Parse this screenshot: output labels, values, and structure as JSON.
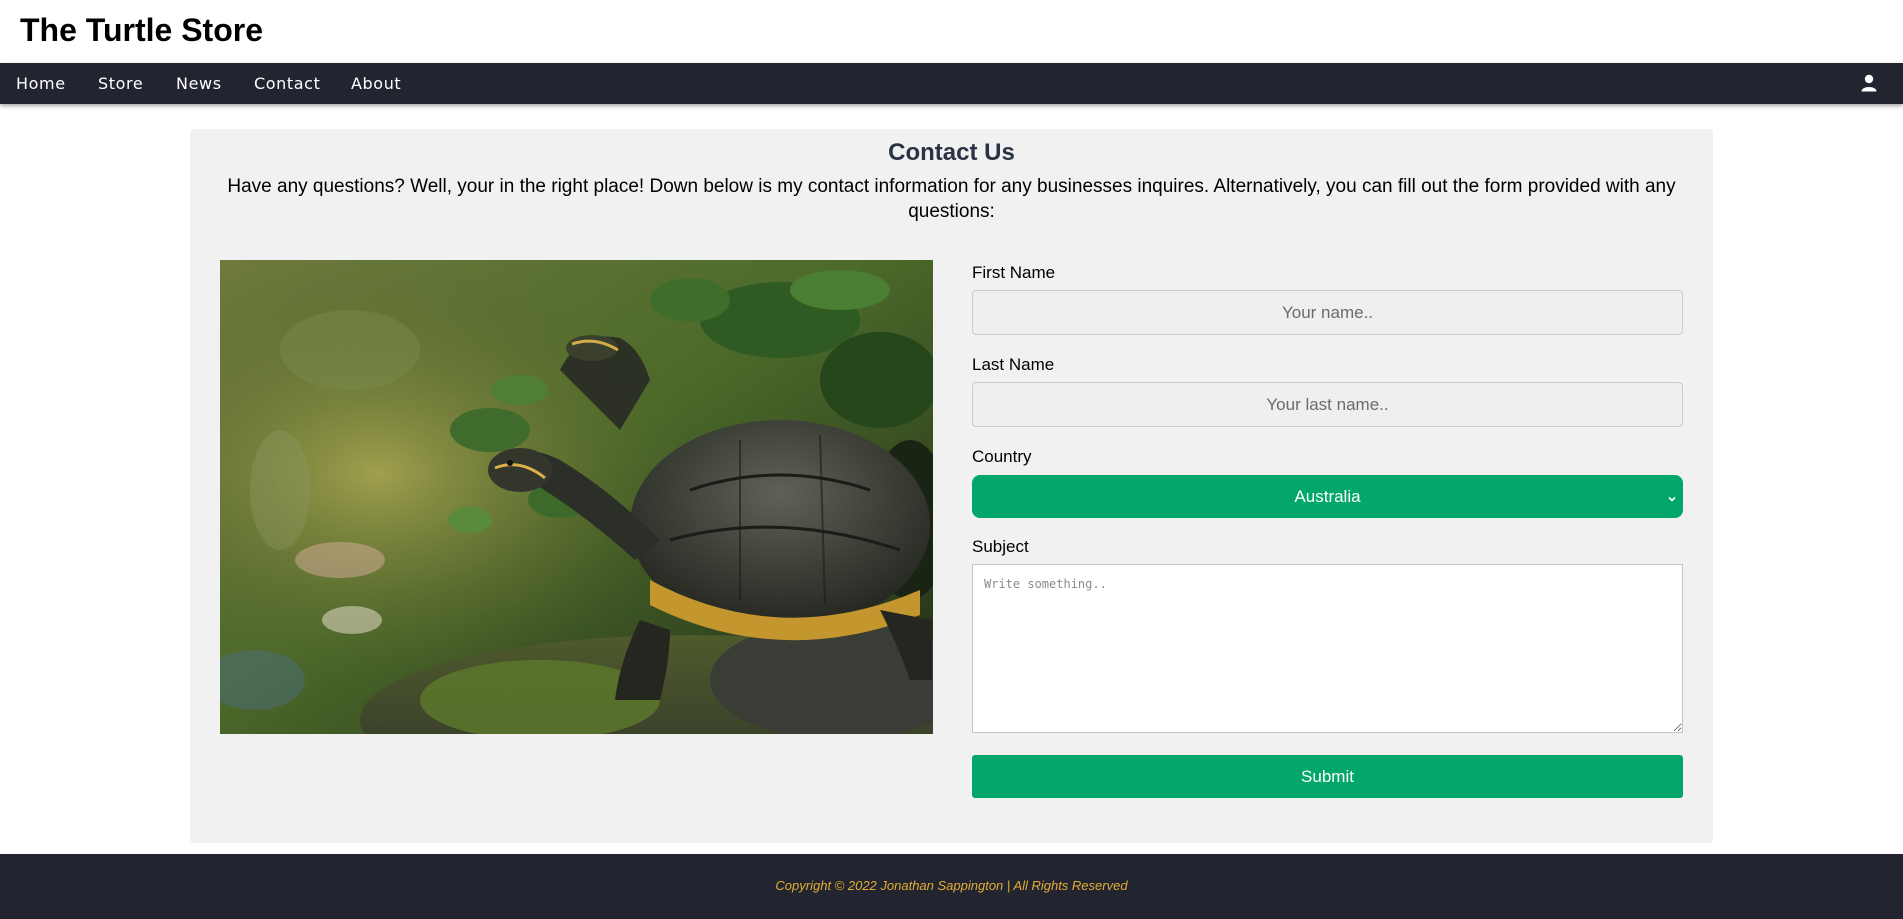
{
  "site": {
    "title": "The Turtle Store"
  },
  "nav": {
    "items": [
      "Home",
      "Store",
      "News",
      "Contact",
      "About"
    ],
    "user_icon": "user-icon"
  },
  "contact": {
    "heading": "Contact Us",
    "intro": "Have any questions? Well, your in the right place! Down below is my contact information for any businesses inquires. Alternatively, you can fill out the form provided with any questions:",
    "image_subject": "turtle on mossy rock"
  },
  "form": {
    "first_name_label": "First Name",
    "first_name_placeholder": "Your name..",
    "first_name_value": "",
    "last_name_label": "Last Name",
    "last_name_placeholder": "Your last name..",
    "last_name_value": "",
    "country_label": "Country",
    "country_selected": "Australia",
    "subject_label": "Subject",
    "subject_placeholder": "Write something..",
    "submit_label": "Submit"
  },
  "footer": {
    "copyright": "Copyright © 2022 Jonathan Sappington | All Rights Reserved"
  },
  "colors": {
    "nav_bg": "#222430",
    "accent_green": "#04a76b",
    "card_bg": "#f1f1f1",
    "heading": "#2b3245",
    "footer_text": "#e2ad33"
  }
}
